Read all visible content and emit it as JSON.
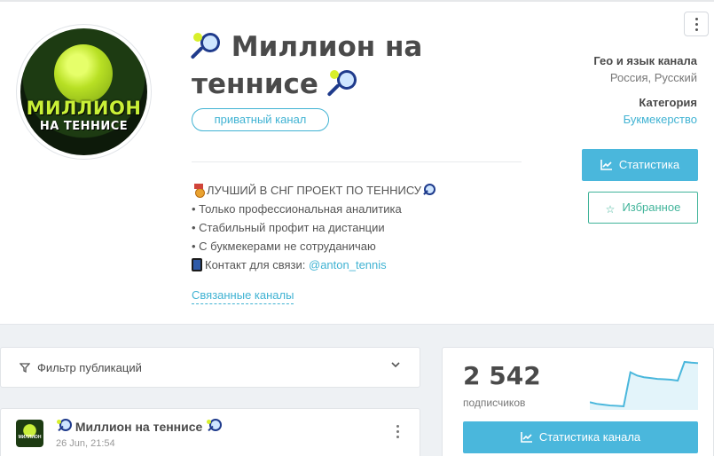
{
  "channel": {
    "title": "Миллион на теннисе",
    "avatar_text_line1": "МИЛЛИОН",
    "avatar_text_line2": "НА ТЕННИСЕ",
    "private_tag": "приватный канал",
    "description": {
      "line1": "ЛУЧШИЙ В СНГ ПРОЕКТ ПО ТЕННИСУ",
      "line2": "• Только профессиональная аналитика",
      "line3": "• Стабильный профит на дистанции",
      "line4": "• С букмекерами не сотруданичаю",
      "line5_prefix": "Контакт для связи: ",
      "line5_link": "@anton_tennis"
    },
    "related_channels": "Связанные каналы"
  },
  "meta": {
    "geo_label": "Гео и язык канала",
    "geo_value": "Россия, Русский",
    "category_label": "Категория",
    "category_value": "Букмекерство"
  },
  "buttons": {
    "stats": "Статистика",
    "favorite": "Избранное",
    "channel_stats": "Статистика канала"
  },
  "filter": {
    "label": "Фильтр публикаций"
  },
  "post": {
    "title": "Миллион на теннисе",
    "date": "26 Jun, 21:54"
  },
  "subscribers": {
    "count": "2 542",
    "label": "подписчиков",
    "trend": [
      2300,
      2290,
      2285,
      2280,
      2278,
      2275,
      2480,
      2460,
      2450,
      2445,
      2440,
      2438,
      2435,
      2430,
      2542,
      2538,
      2535
    ]
  },
  "colors": {
    "accent": "#4ab7dc",
    "favorite": "#41b49a",
    "link": "#41b3d3"
  }
}
